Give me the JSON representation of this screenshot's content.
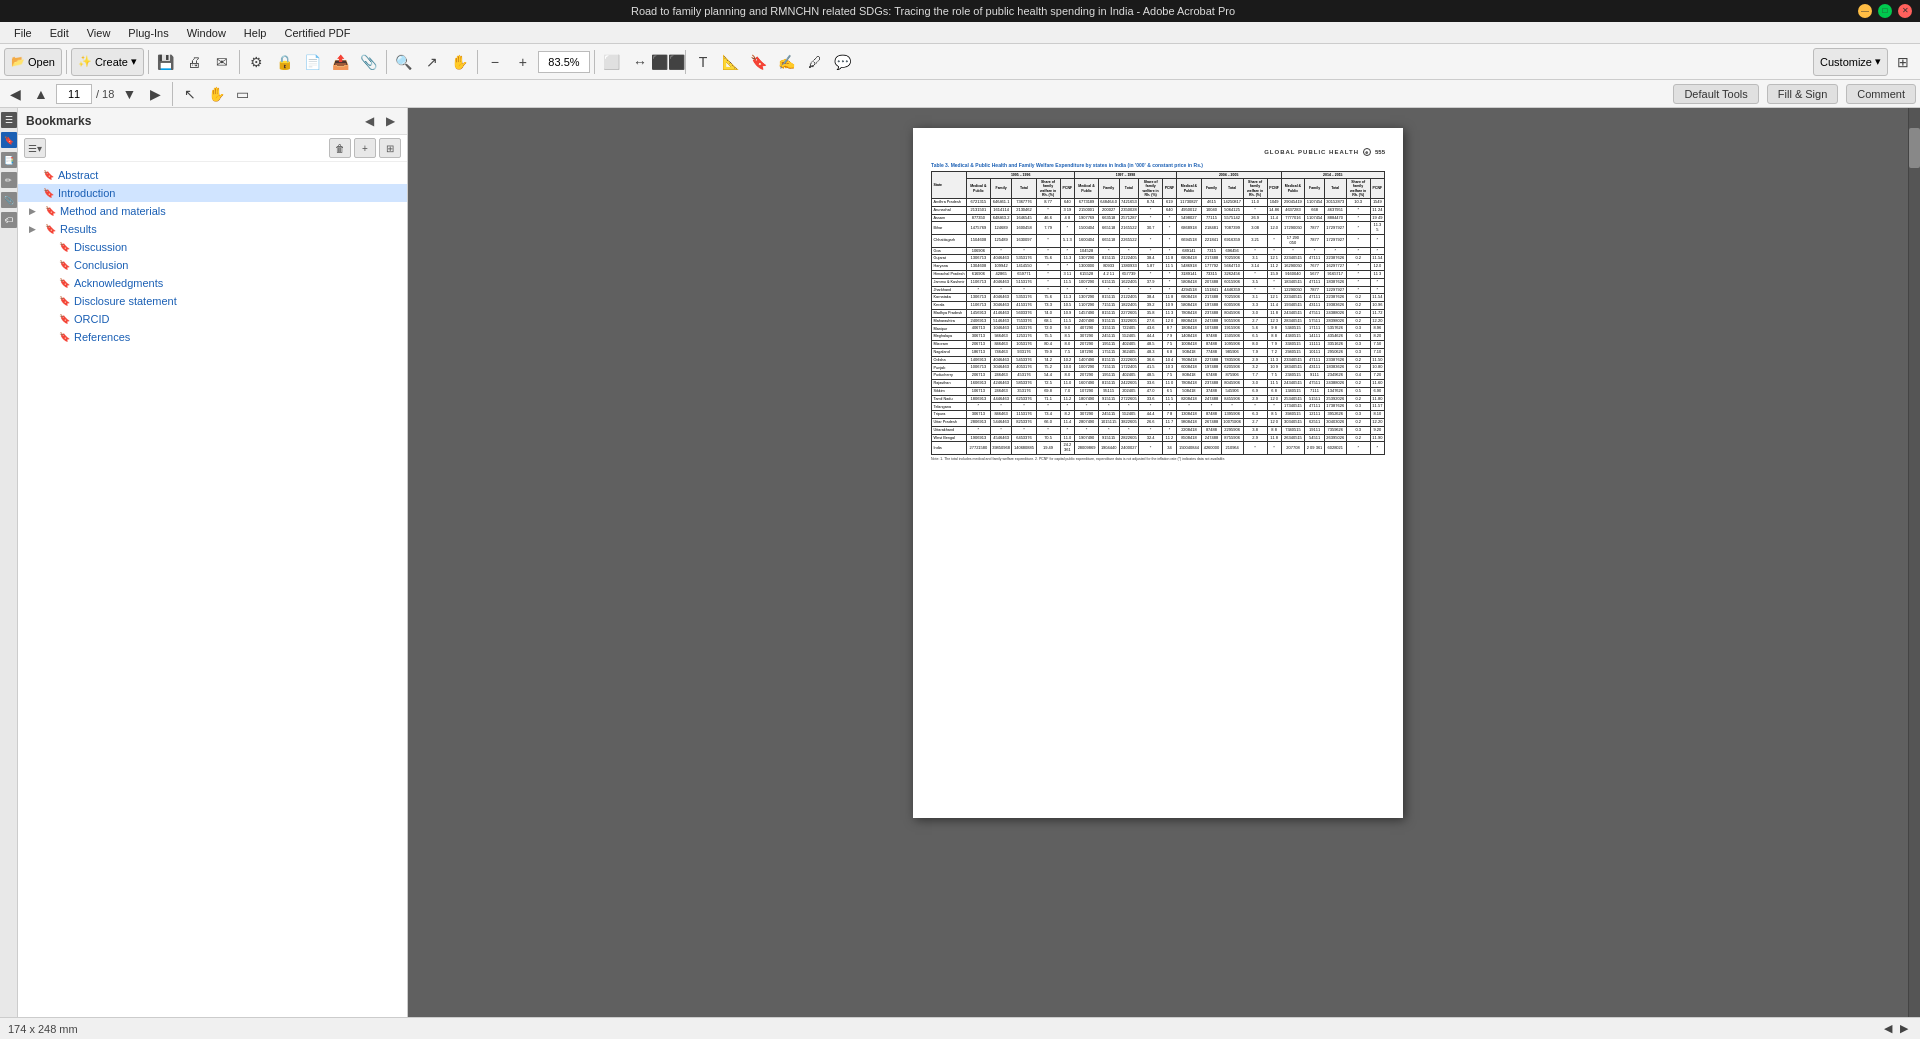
{
  "window": {
    "title": "Road to family planning and RMNCHN related SDGs: Tracing the role of public health spending in India - Adobe Acrobat Pro"
  },
  "titlebar": {
    "minimize": "—",
    "maximize": "□",
    "close": "✕"
  },
  "menubar": {
    "items": [
      "File",
      "Edit",
      "View",
      "Plug-Ins",
      "Window",
      "Help",
      "Certified PDF"
    ]
  },
  "toolbar": {
    "open_label": "Open",
    "create_label": "Create",
    "customize_label": "Customize",
    "zoom_value": "83.5%"
  },
  "nav": {
    "current_page": "11",
    "total_pages": "18",
    "tools": [
      "Default Tools",
      "Fill & Sign",
      "Comment"
    ]
  },
  "bookmarks": {
    "panel_title": "Bookmarks",
    "items": [
      {
        "label": "Abstract",
        "level": 0,
        "expandable": false,
        "active": false
      },
      {
        "label": "Introduction",
        "level": 0,
        "expandable": false,
        "active": true
      },
      {
        "label": "Method and materials",
        "level": 0,
        "expandable": true,
        "active": false
      },
      {
        "label": "Results",
        "level": 0,
        "expandable": true,
        "active": false
      },
      {
        "label": "Discussion",
        "level": 1,
        "expandable": false,
        "active": false
      },
      {
        "label": "Conclusion",
        "level": 1,
        "expandable": false,
        "active": false
      },
      {
        "label": "Acknowledgments",
        "level": 1,
        "expandable": false,
        "active": false
      },
      {
        "label": "Disclosure statement",
        "level": 1,
        "expandable": false,
        "active": false
      },
      {
        "label": "ORCID",
        "level": 1,
        "expandable": false,
        "active": false
      },
      {
        "label": "References",
        "level": 1,
        "expandable": false,
        "active": false
      }
    ]
  },
  "pdf": {
    "page_header": {
      "journal": "GLOBAL PUBLIC HEALTH",
      "page_num": "555"
    },
    "table": {
      "caption": "Table 3. Medical & Public Health and Family Welfare Expenditure by states in India (in '000' & constant price in Rs.)",
      "note": "Note: 1. The total includes medical and family welfare expenditure. 2. PCNF for capital public expenditure, expenditure data is not adjusted for the inflation rate (*) indicates data not available.",
      "col_groups": [
        "1995 - 1996",
        "1997 - 1998",
        "2004 - 2005",
        "2014 - 2015"
      ],
      "sub_cols": [
        "Medical & Public",
        "Family",
        "Total",
        "Share of family welfare in Rh. (%)",
        "PCNF",
        "Medical & Public",
        "Family",
        "Total",
        "Share of family welfare in Rh. (%)",
        "PCNF",
        "Medical & Public",
        "Family",
        "Total",
        "Share of family welfare in Rh. (%)",
        "PCNF",
        "Medical & Public",
        "Family",
        "Total",
        "Share of family welfare in Rh. (%)",
        "PCNF"
      ],
      "states": [
        "Andhra Pradesh",
        "Arunachal",
        "Assam",
        "Bihar",
        "Chhattisgarh",
        "Goa",
        "Gujarat",
        "Haryana",
        "Himachal Pradesh",
        "Jammu & Kashmir",
        "Jharkhand",
        "Karnataka",
        "Kerala",
        "Madhya Pradesh",
        "Maharashtra",
        "Manipur",
        "Meghalaya",
        "Mizoram",
        "Nagaland",
        "Odisha",
        "Punjab",
        "Puducherry",
        "Rajasthan",
        "Sikkim",
        "Tamil Nadu",
        "Telangana",
        "Tripura",
        "Uttar Pradesh",
        "Uttarakhand",
        "West Bengal",
        "India"
      ],
      "data": []
    },
    "page_size": "174 x 248 mm"
  }
}
